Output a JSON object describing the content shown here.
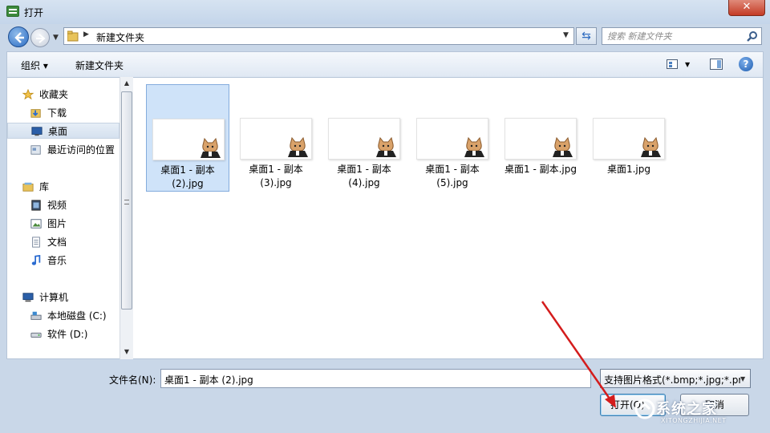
{
  "window": {
    "title": "打开",
    "close_label": "✕"
  },
  "address": {
    "path": "新建文件夹",
    "search_placeholder": "搜索 新建文件夹"
  },
  "toolbar": {
    "organize_label": "组织 ▾",
    "new_folder_label": "新建文件夹"
  },
  "sidebar": {
    "favorites": {
      "label": "收藏夹",
      "items": [
        {
          "label": "下载"
        },
        {
          "label": "桌面"
        },
        {
          "label": "最近访问的位置"
        }
      ]
    },
    "libraries": {
      "label": "库",
      "items": [
        {
          "label": "视频"
        },
        {
          "label": "图片"
        },
        {
          "label": "文档"
        },
        {
          "label": "音乐"
        }
      ]
    },
    "computer": {
      "label": "计算机",
      "items": [
        {
          "label": "本地磁盘 (C:)"
        },
        {
          "label": "软件 (D:)"
        }
      ]
    }
  },
  "files": [
    {
      "line1": "桌面1 - 副本",
      "line2": "(2).jpg"
    },
    {
      "line1": "桌面1 - 副本",
      "line2": "(3).jpg"
    },
    {
      "line1": "桌面1 - 副本",
      "line2": "(4).jpg"
    },
    {
      "line1": "桌面1 - 副本",
      "line2": "(5).jpg"
    },
    {
      "line1": "桌面1 - 副本.jpg",
      "line2": ""
    },
    {
      "line1": "桌面1.jpg",
      "line2": ""
    }
  ],
  "bottom": {
    "filename_label": "文件名(N):",
    "filename_value": "桌面1 - 副本 (2).jpg",
    "filter_value": "支持图片格式(*.bmp;*.jpg;*.pr",
    "open_label": "打开(O)",
    "cancel_label": "取消"
  },
  "watermark": {
    "text": "系统之家",
    "sub": "XITONGZHIJIA.NET"
  }
}
